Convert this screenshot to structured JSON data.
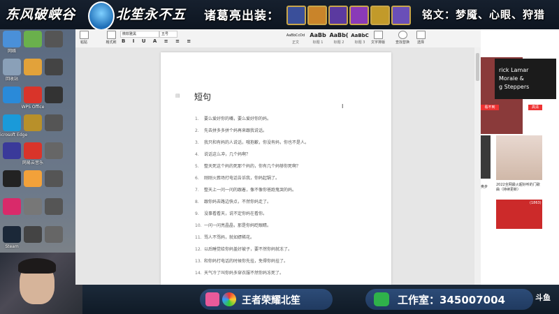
{
  "banner": {
    "left_text": "东风破峡谷",
    "mid_text": "北笙永不五",
    "equip_text": "诸葛亮出装：",
    "rune_text": "铭文：梦魇、心眼、狩猎",
    "hero_colors": [
      "#3a4f9a",
      "#c9842a",
      "#5b3aa0",
      "#8a3ab8",
      "#c29a2a",
      "#6a4fb8"
    ]
  },
  "desktop_icons": [
    {
      "label": "网络",
      "color": "#4a90d9"
    },
    {
      "label": "",
      "color": "#6ab04c"
    },
    {
      "label": "",
      "color": "#555"
    },
    {
      "label": "回收站",
      "color": "#8aa0b8"
    },
    {
      "label": "",
      "color": "#e2a23a"
    },
    {
      "label": "",
      "color": "#444"
    },
    {
      "label": "",
      "color": "#2a8ad9"
    },
    {
      "label": "WPS Office",
      "color": "#d9342a"
    },
    {
      "label": "",
      "color": "#333"
    },
    {
      "label": "Microsoft Edge",
      "color": "#1a9ad9"
    },
    {
      "label": "",
      "color": "#b8902a"
    },
    {
      "label": "",
      "color": "#555"
    },
    {
      "label": "",
      "color": "#3a3a9a"
    },
    {
      "label": "网易云音乐",
      "color": "#d9342a"
    },
    {
      "label": "",
      "color": "#666"
    },
    {
      "label": "",
      "color": "#222"
    },
    {
      "label": "",
      "color": "#f2a13a"
    },
    {
      "label": "",
      "color": "#555"
    },
    {
      "label": "",
      "color": "#d92a6a"
    },
    {
      "label": "",
      "color": "#777"
    },
    {
      "label": "",
      "color": "#555"
    },
    {
      "label": "Steam",
      "color": "#1b2838"
    },
    {
      "label": "",
      "color": "#444"
    },
    {
      "label": "",
      "color": "#666"
    }
  ],
  "ribbon": {
    "tools": [
      "粘贴",
      "格式刷"
    ],
    "font_name": "微软雅黑",
    "font_size": "五号",
    "styles": [
      {
        "sample": "AaBbCcDd",
        "name": "正文"
      },
      {
        "sample": "AaBb",
        "name": "标题 1"
      },
      {
        "sample": "AaBb(",
        "name": "标题 2"
      },
      {
        "sample": "AaBbC",
        "name": "标题 3"
      }
    ],
    "right_tools": [
      "文字排版",
      "查找替换",
      "选择"
    ]
  },
  "document": {
    "title": "短句",
    "lines": [
      "要么爱好你的嘴，要么爱好你的妈。",
      "先去拼多多拼个妈再来跟我说话。",
      "我只和有妈的人说话，哦抱歉，你没有妈，你也不是人。",
      "说话这么冲，几个妈啊？",
      "整天死这个妈的死那个妈的，你有几个妈够你死啊？",
      "刚刚火葬场打电话告诉我，你妈起锅了。",
      "整天上一问一问的跟着，像不像你爸跑鬼哭的妈。",
      "跟你妈去路边快点，不然你妈走了。",
      "没事看看天，说不定你妈在看你。",
      "一问一问亮晶晶，那是你妈眨眼睛。",
      "骂人不骂妈，就如嫖稀花。",
      "以后睡觉给你妈盖好被子，要不然你妈就冻了。",
      "和你妈打电话的时候你先挂，免得你妈挂了。",
      "天气冷了叫你妈多穿衣服不然你妈冻死了。"
    ]
  },
  "browser": {
    "card_text": [
      "rick Lamar",
      "Morale &",
      "g Steppers"
    ],
    "tag1": "看不到",
    "tag2": "高清",
    "caption_left": "奥步",
    "caption_right": "2022全网最火超好听的门歌曲（持续更新）",
    "badge": "(1863)"
  },
  "taskbar": {
    "app_name": "王者荣耀北笙",
    "studio_label": "工作室：",
    "studio_number": "345007004",
    "logo_text": "斗鱼"
  }
}
